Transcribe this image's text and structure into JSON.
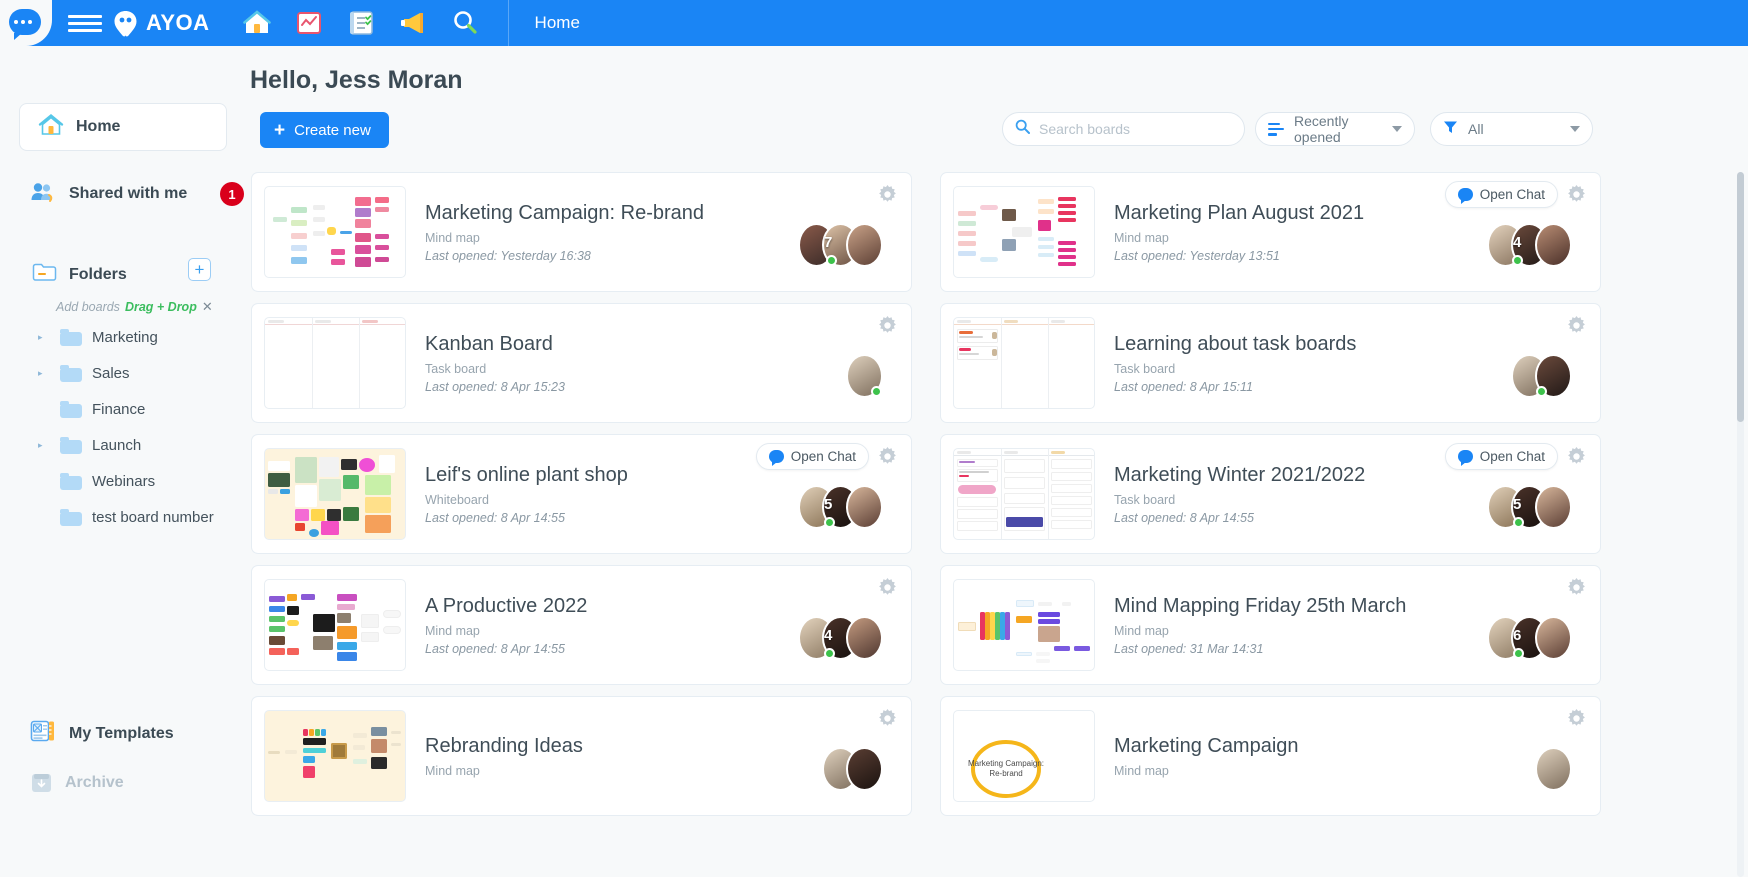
{
  "topbar": {
    "brand": "AYOA",
    "page_label": "Home",
    "icons": [
      "home-icon",
      "notes-icon",
      "tasks-icon",
      "megaphone-icon",
      "search-icon"
    ],
    "accent_color": "#1a85f5"
  },
  "sidebar": {
    "home": {
      "label": "Home"
    },
    "shared": {
      "label": "Shared with me",
      "badge": "1"
    },
    "folders": {
      "label": "Folders",
      "add_label": "+"
    },
    "drag_drop": {
      "prefix": "Add boards",
      "emphasis": "Drag + Drop",
      "close": "✕"
    },
    "folder_items": [
      {
        "label": "Marketing",
        "expandable": true
      },
      {
        "label": "Sales",
        "expandable": true
      },
      {
        "label": "Finance",
        "expandable": false
      },
      {
        "label": "Launch",
        "expandable": true
      },
      {
        "label": "Webinars",
        "expandable": false
      },
      {
        "label": "test board number",
        "expandable": false
      }
    ],
    "my_templates": {
      "label": "My Templates"
    },
    "archive": {
      "label": "Archive"
    }
  },
  "main": {
    "greeting": "Hello, Jess Moran",
    "create_button": {
      "label": "Create new",
      "plus": "+"
    },
    "search": {
      "placeholder": "Search boards",
      "value": ""
    },
    "sort_dropdown": {
      "label": "Recently opened"
    },
    "filter_dropdown": {
      "label": "All"
    }
  },
  "boards": [
    {
      "title": "Marketing Campaign: Re-brand",
      "type": "Mind map",
      "opened": "Last opened: Yesterday 16:38",
      "has_chat": false,
      "thumb": "mindmap-pink",
      "avatar_count": "7",
      "avatars": 3
    },
    {
      "title": "Marketing Plan August 2021",
      "type": "Mind map",
      "opened": "Last opened: Yesterday 13:51",
      "has_chat": true,
      "chat_label": "Open Chat",
      "thumb": "mindmap-red",
      "avatar_count": "4",
      "avatars": 3
    },
    {
      "title": "Kanban Board",
      "type": "Task board",
      "opened": "Last opened: 8 Apr 15:23",
      "has_chat": false,
      "thumb": "kanban-empty",
      "avatar_count": "",
      "avatars": 1
    },
    {
      "title": "Learning about task boards",
      "type": "Task board",
      "opened": "Last opened: 8 Apr 15:11",
      "has_chat": false,
      "thumb": "kanban-cards",
      "avatar_count": "",
      "avatars": 2
    },
    {
      "title": "Leif's online plant shop",
      "type": "Whiteboard",
      "opened": "Last opened: 8 Apr 14:55",
      "has_chat": true,
      "chat_label": "Open Chat",
      "thumb": "whiteboard-cream",
      "avatar_count": "5",
      "avatars": 3
    },
    {
      "title": "Marketing Winter 2021/2022",
      "type": "Task board",
      "opened": "Last opened: 8 Apr 14:55",
      "has_chat": true,
      "chat_label": "Open Chat",
      "thumb": "kanban-full",
      "avatar_count": "5",
      "avatars": 3
    },
    {
      "title": "A Productive 2022",
      "type": "Mind map",
      "opened": "Last opened: 8 Apr 14:55",
      "has_chat": false,
      "thumb": "mindmap-dark",
      "avatar_count": "4",
      "avatars": 3
    },
    {
      "title": "Mind Mapping Friday 25th March",
      "type": "Mind map",
      "opened": "Last opened: 31 Mar 14:31",
      "has_chat": false,
      "thumb": "mindmap-rainbow",
      "avatar_count": "6",
      "avatars": 3
    },
    {
      "title": "Rebranding Ideas",
      "type": "Mind map",
      "opened": "",
      "has_chat": false,
      "thumb": "mindmap-cream",
      "avatar_count": "",
      "avatars": 2
    },
    {
      "title": "Marketing Campaign",
      "type": "Mind map",
      "opened": "",
      "has_chat": false,
      "thumb": "circle-yellow",
      "thumb_text": "Marketing Campaign: Re-brand",
      "avatar_count": "",
      "avatars": 1
    }
  ]
}
